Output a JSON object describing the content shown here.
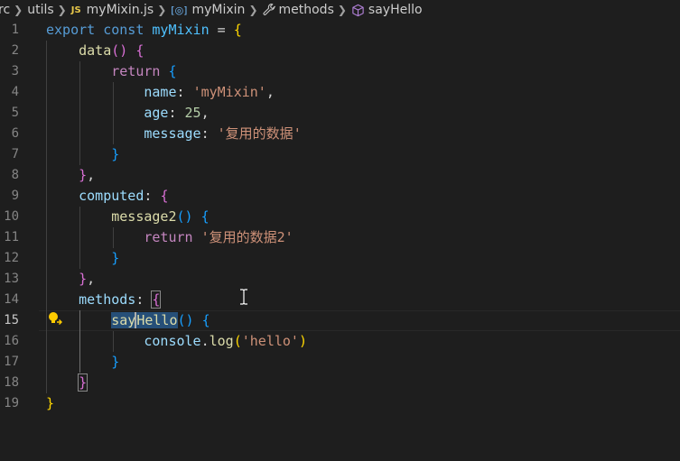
{
  "breadcrumb": {
    "items": [
      {
        "label": "rc",
        "icon": ""
      },
      {
        "label": "utils",
        "icon": ""
      },
      {
        "label": "myMixin.js",
        "icon": "js-file-icon",
        "icon_text": "JS"
      },
      {
        "label": "myMixin",
        "icon": "variable-icon",
        "icon_text": "[◎]"
      },
      {
        "label": "methods",
        "icon": "wrench-icon"
      },
      {
        "label": "sayHello",
        "icon": "method-cube-icon"
      }
    ]
  },
  "editor": {
    "active_line": 15,
    "lines": [
      {
        "num": "1"
      },
      {
        "num": "2"
      },
      {
        "num": "3"
      },
      {
        "num": "4"
      },
      {
        "num": "5"
      },
      {
        "num": "6"
      },
      {
        "num": "7"
      },
      {
        "num": "8"
      },
      {
        "num": "9"
      },
      {
        "num": "10"
      },
      {
        "num": "11"
      },
      {
        "num": "12"
      },
      {
        "num": "13"
      },
      {
        "num": "14"
      },
      {
        "num": "15"
      },
      {
        "num": "16"
      },
      {
        "num": "17"
      },
      {
        "num": "18"
      },
      {
        "num": "19"
      }
    ],
    "tokens": {
      "l1_export": "export",
      "l1_const": "const",
      "l1_name": "myMixin",
      "l1_eq": " = ",
      "l1_open": "{",
      "l2_fn": "data",
      "l2_parens": "()",
      "l2_open": "{",
      "l3_return": "return",
      "l3_open": "{",
      "l4_key": "name",
      "l4_colon": ": ",
      "l4_val": "'myMixin'",
      "l4_comma": ",",
      "l5_key": "age",
      "l5_colon": ": ",
      "l5_val": "25",
      "l5_comma": ",",
      "l6_key": "message",
      "l6_colon": ": ",
      "l6_val": "'复用的数据'",
      "l7_close": "}",
      "l8_close": "}",
      "l8_comma": ",",
      "l9_key": "computed",
      "l9_colon": ": ",
      "l9_open": "{",
      "l10_fn": "message2",
      "l10_parens": "()",
      "l10_open": "{",
      "l11_return": "return",
      "l11_val": "'复用的数据2'",
      "l12_close": "}",
      "l13_close": "}",
      "l13_comma": ",",
      "l14_key": "methods",
      "l14_colon": ": ",
      "l14_open": "{",
      "l15_fn_a": "say",
      "l15_fn_b": "Hello",
      "l15_parens": "()",
      "l15_open": "{",
      "l16_obj": "console",
      "l16_dot": ".",
      "l16_fn": "log",
      "l16_open": "(",
      "l16_val": "'hello'",
      "l16_close": ")",
      "l17_close": "}",
      "l18_close": "}",
      "l19_close": "}"
    }
  },
  "colors": {
    "background": "#1e1e1e",
    "keyword": "#569cd6",
    "control_keyword": "#c586c0",
    "constant": "#4fc1ff",
    "function": "#dcdcaa",
    "property": "#9cdcfe",
    "string": "#ce9178",
    "number": "#b5cea8",
    "bracket_level1": "#ffd700",
    "bracket_level2": "#da70d6",
    "bracket_level3": "#179fff",
    "selection": "#264f78"
  }
}
